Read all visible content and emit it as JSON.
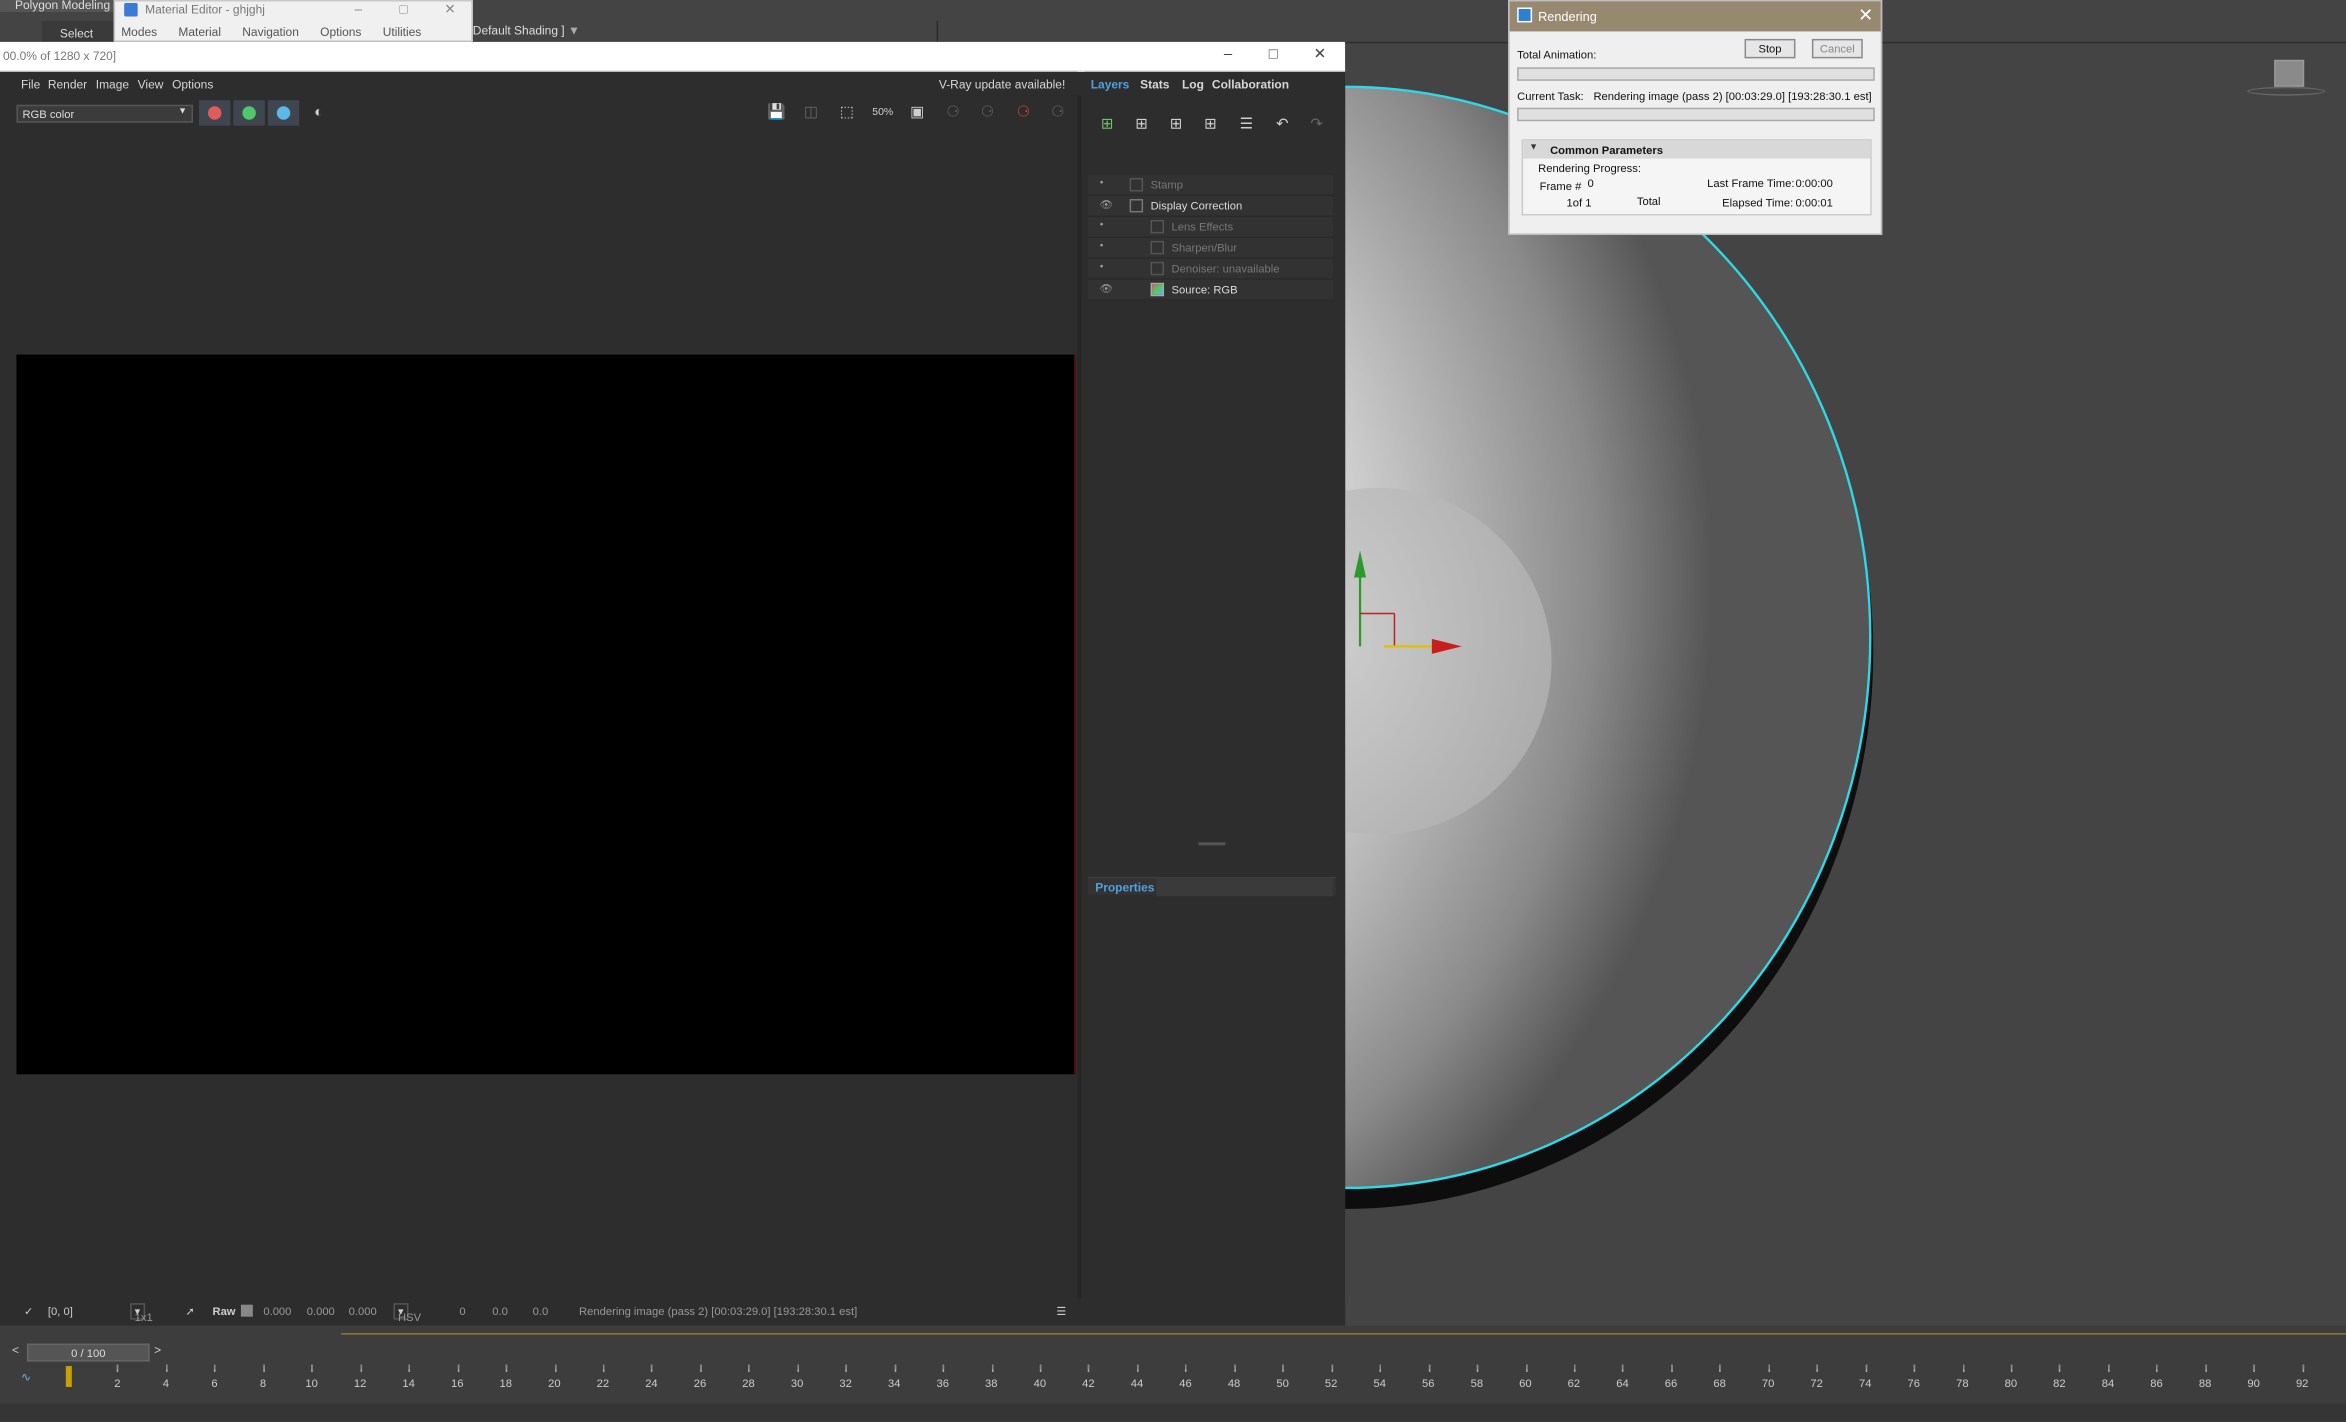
{
  "max": {
    "ribbon_tab": "Polygon Modeling",
    "select_tab": "Select",
    "viewport_label": "Default Shading ]"
  },
  "material_editor": {
    "title": "Material Editor - ghjghj",
    "menu": [
      "Modes",
      "Material",
      "Navigation",
      "Options",
      "Utilities"
    ]
  },
  "vfb": {
    "title": "00.0% of 1280 x 720]",
    "menu": [
      "File",
      "Render",
      "Image",
      "View",
      "Options"
    ],
    "update_notice": "V-Ray update available!",
    "channel": "RGB color",
    "colors": {
      "red": "#e05b5b",
      "green": "#4fc86b",
      "blue": "#5bb8e8"
    },
    "layer_tabs": [
      "Layers",
      "Stats",
      "Log",
      "Collaboration"
    ],
    "layers": [
      {
        "label": "Stamp",
        "enabled": false
      },
      {
        "label": "Display Correction",
        "enabled": true
      },
      {
        "label": "Lens Effects",
        "enabled": false
      },
      {
        "label": "Sharpen/Blur",
        "enabled": false
      },
      {
        "label": "Denoiser: unavailable",
        "enabled": false
      },
      {
        "label": "Source: RGB",
        "enabled": true
      }
    ],
    "properties_label": "Properties",
    "status": {
      "coords": "[0, 0]",
      "zoom": "1x1",
      "raw": "Raw",
      "r": "0.000",
      "g": "0.000",
      "b": "0.000",
      "mode": "HSV",
      "h": "0",
      "s": "0.0",
      "v": "0.0",
      "message": "Rendering image (pass 2) [00:03:29.0] [193:28:30.1 est]"
    }
  },
  "rendering": {
    "title": "Rendering",
    "total_animation": "Total Animation:",
    "stop": "Stop",
    "cancel": "Cancel",
    "current_task_label": "Current Task:",
    "current_task": "Rendering image (pass 2) [00:03:29.0] [193:28:30.1 est]",
    "common_parameters": "Common Parameters",
    "rendering_progress": "Rendering Progress:",
    "frame_label": "Frame #",
    "frame_value": "0",
    "of_label": "1of 1",
    "total_label": "Total",
    "last_frame_time_label": "Last Frame Time:",
    "last_frame_time": "0:00:00",
    "elapsed_time_label": "Elapsed Time:",
    "elapsed_time": "0:00:01"
  },
  "timeline": {
    "frame": "0 / 100",
    "ticks": [
      "2",
      "4",
      "6",
      "8",
      "10",
      "12",
      "14",
      "16",
      "18",
      "20",
      "22",
      "24",
      "26",
      "28",
      "30",
      "32",
      "34",
      "36",
      "38",
      "40",
      "42",
      "44",
      "46",
      "48",
      "50",
      "52",
      "54",
      "56",
      "58",
      "60",
      "62",
      "64",
      "66",
      "68",
      "70",
      "72",
      "74",
      "76",
      "78",
      "80",
      "82",
      "84",
      "86",
      "88",
      "90",
      "92"
    ]
  }
}
